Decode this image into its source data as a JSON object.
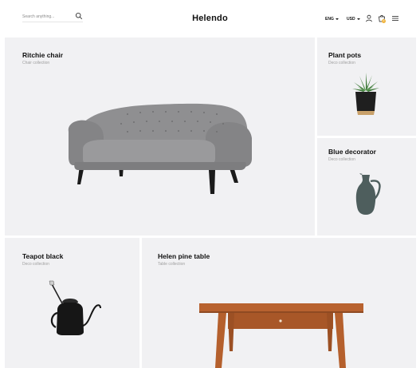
{
  "header": {
    "search_placeholder": "Search anything...",
    "logo": "Helendo",
    "language": "ENG",
    "currency": "USD",
    "cart_count": "0",
    "icons": [
      "search-icon",
      "user-icon",
      "cart-icon",
      "menu-icon"
    ]
  },
  "tiles": [
    {
      "title": "Ritchie chair",
      "subtitle": "Chair collection"
    },
    {
      "title": "Plant pots",
      "subtitle": "Deco collection"
    },
    {
      "title": "Blue decorator",
      "subtitle": "Deco collection"
    },
    {
      "title": "Teapot black",
      "subtitle": "Deco collection"
    },
    {
      "title": "Helen pine table",
      "subtitle": "Table collection"
    }
  ],
  "colors": {
    "tile_bg": "#f1f1f3",
    "badge": "#f0b33a",
    "sofa": "#8e8e90",
    "vase": "#4c5c5c",
    "table": "#b8622f"
  }
}
